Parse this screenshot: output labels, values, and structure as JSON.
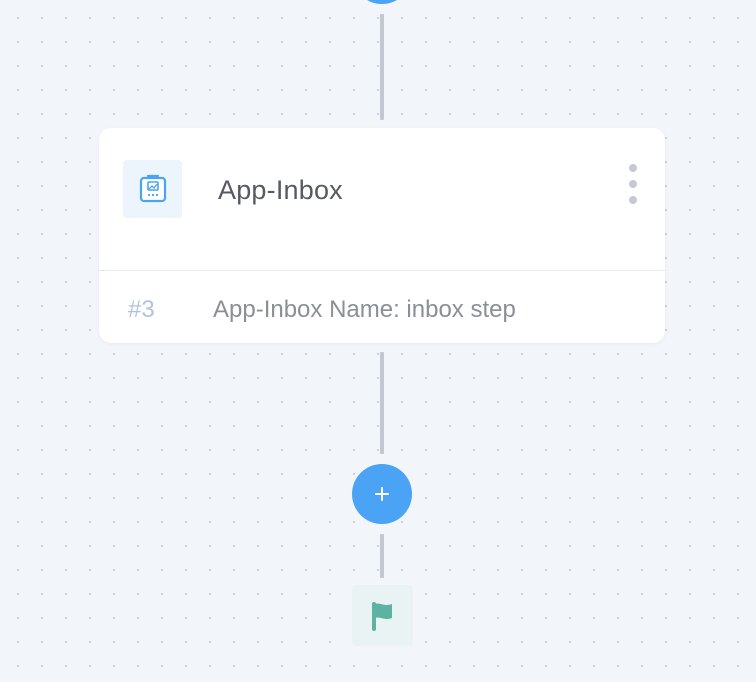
{
  "canvas": {
    "background_color": "#f2f5fa",
    "dot_color": "#c9d0db"
  },
  "step_card": {
    "title": "App-Inbox",
    "icon": "app-inbox-icon",
    "step_number": "#3",
    "description": "App-Inbox Name: inbox step",
    "menu_icon": "kebab-menu-icon"
  },
  "flow": {
    "add_step_icon": "plus-icon",
    "end_icon": "flag-icon"
  },
  "colors": {
    "accent": "#4aa3f4",
    "connector": "#c3c7cf",
    "flag": "#5bb3a0",
    "step_number": "#b2c2dd"
  }
}
